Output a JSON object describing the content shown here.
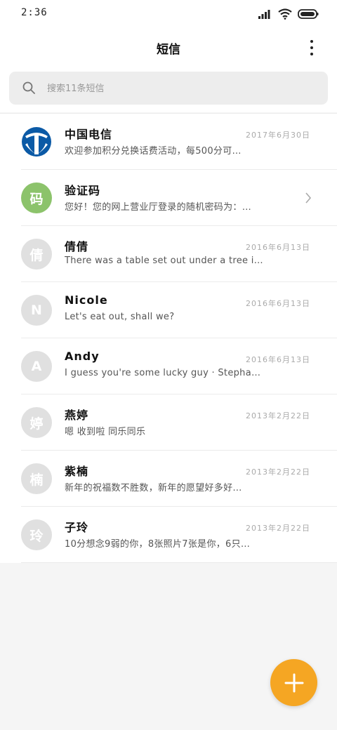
{
  "status_bar": {
    "time": "2:36"
  },
  "header": {
    "title": "短信"
  },
  "search": {
    "placeholder": "搜索11条短信"
  },
  "messages": [
    {
      "name": "中国电信",
      "date": "2017年6月30日",
      "preview": "欢迎参加积分兑换话费活动，每500分可…",
      "avatar_text": "",
      "avatar_icon": "china-telecom-logo"
    },
    {
      "name": "验证码",
      "date": "",
      "preview": "您好！您的网上营业厅登录的随机密码为：…",
      "avatar_text": "码",
      "avatar_color": "#8cc36b"
    },
    {
      "name": "倩倩",
      "date": "2016年6月13日",
      "preview": "There was a table set out under a tree i…",
      "avatar_text": "倩"
    },
    {
      "name": "Nicole",
      "date": "2016年6月13日",
      "preview": "Let's eat out, shall we?",
      "avatar_text": "N"
    },
    {
      "name": "Andy",
      "date": "2016年6月13日",
      "preview": "I guess you're some lucky guy · Stepha…",
      "avatar_text": "A"
    },
    {
      "name": "燕婷",
      "date": "2013年2月22日",
      "preview": "嗯 收到啦 同乐同乐",
      "avatar_text": "婷"
    },
    {
      "name": "紫楠",
      "date": "2013年2月22日",
      "preview": "新年的祝福数不胜数，新年的愿望好多好…",
      "avatar_text": "楠"
    },
    {
      "name": "子玲",
      "date": "2013年2月22日",
      "preview": "10分想念9弱的你，8张照片7张是你，6只…",
      "avatar_text": "玲"
    }
  ],
  "colors": {
    "accent": "#f5a623",
    "telecom_blue": "#0b5aa6",
    "verify_green": "#8cc36b",
    "avatar_gray": "#e0e0e0"
  }
}
